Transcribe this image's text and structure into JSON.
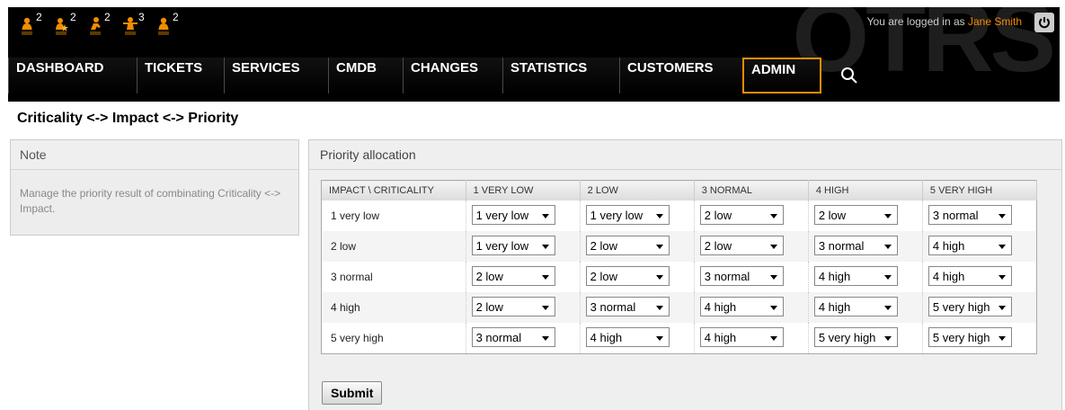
{
  "toolbar": [
    {
      "icon": "person-icon",
      "count": "2"
    },
    {
      "icon": "person-star-icon",
      "count": "2"
    },
    {
      "icon": "person-run-icon",
      "count": "2"
    },
    {
      "icon": "person-arms-icon",
      "count": "3"
    },
    {
      "icon": "person-icon",
      "count": "2"
    }
  ],
  "login": {
    "prefix": "You are logged in as",
    "user": "Jane Smith"
  },
  "watermark": "OTRS",
  "nav": [
    "DASHBOARD",
    "TICKETS",
    "SERVICES",
    "CMDB",
    "CHANGES",
    "STATISTICS",
    "CUSTOMERS",
    "ADMIN"
  ],
  "active_nav": "ADMIN",
  "page_title": "Criticality <-> Impact <-> Priority",
  "note": {
    "title": "Note",
    "text": "Manage the priority result of combinating Criticality <-> Impact."
  },
  "allocation": {
    "title": "Priority allocation",
    "corner": "IMPACT \\ CRITICALITY",
    "columns": [
      "1 VERY LOW",
      "2 LOW",
      "3 NORMAL",
      "4 HIGH",
      "5 VERY HIGH"
    ],
    "rows": [
      {
        "impact": "1 very low",
        "values": [
          "1 very low",
          "1 very low",
          "2 low",
          "2 low",
          "3 normal"
        ]
      },
      {
        "impact": "2 low",
        "values": [
          "1 very low",
          "2 low",
          "2 low",
          "3 normal",
          "4 high"
        ]
      },
      {
        "impact": "3 normal",
        "values": [
          "2 low",
          "2 low",
          "3 normal",
          "4 high",
          "4 high"
        ]
      },
      {
        "impact": "4 high",
        "values": [
          "2 low",
          "3 normal",
          "4 high",
          "4 high",
          "5 very high"
        ]
      },
      {
        "impact": "5 very high",
        "values": [
          "3 normal",
          "4 high",
          "4 high",
          "5 very high",
          "5 very high"
        ]
      }
    ]
  },
  "submit_label": "Submit",
  "colors": {
    "accent": "#f28d00",
    "header_bg": "#000000"
  }
}
